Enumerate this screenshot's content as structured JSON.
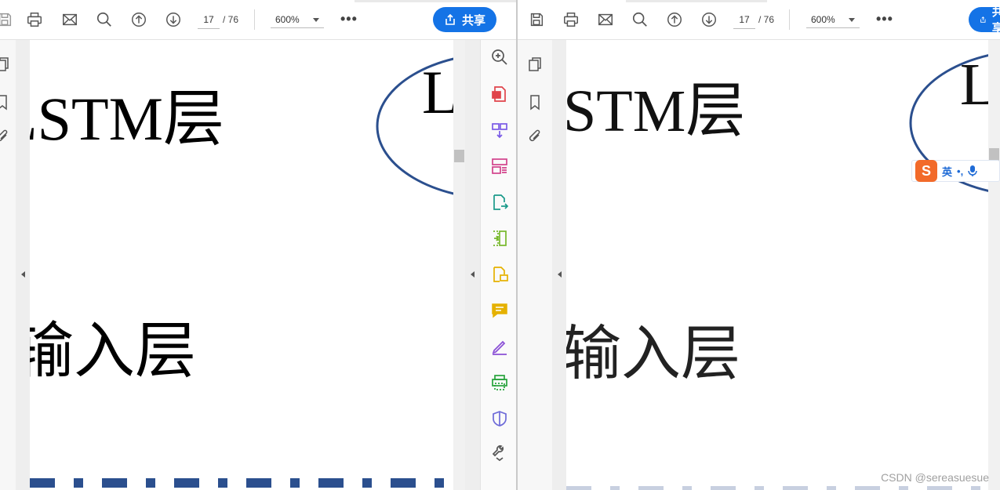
{
  "toolbar": {
    "page_current": "17",
    "page_total": "/ 76",
    "zoom": "600%",
    "more_label": "•••",
    "share_label": "共享"
  },
  "document": {
    "lstm_label": "LSTM层",
    "lstm_label_right": "STM层",
    "input_label": "输入层",
    "ellipse_letter": "L"
  },
  "ime": {
    "logo": "S",
    "mode": "英",
    "punct": "•,"
  },
  "watermark": "CSDN @sereasuesue",
  "colors": {
    "accent": "#1473e6",
    "ellipse": "#2b4f8e"
  },
  "icons": {
    "toolbar": [
      "save-icon",
      "print-icon",
      "mail-icon",
      "search-icon",
      "page-up-icon",
      "page-down-icon"
    ],
    "left_nav": [
      "page-thumbnails-icon",
      "bookmark-icon",
      "attachment-icon"
    ],
    "right_panel": [
      "zoom-in-icon",
      "export-pdf-icon",
      "create-pdf-icon",
      "organize-pages-icon",
      "export-icon",
      "compress-icon",
      "fill-sign-icon",
      "comment-icon",
      "sign-icon",
      "print-production-icon",
      "protect-icon",
      "tools-icon"
    ]
  }
}
